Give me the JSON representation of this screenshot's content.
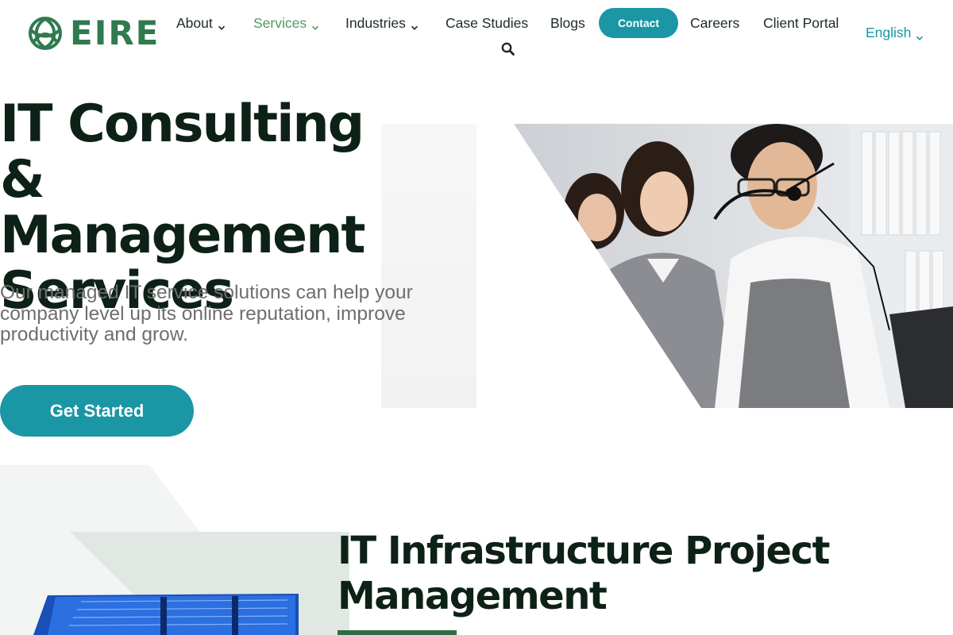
{
  "brand": {
    "name": "EIRE",
    "logo_icon": "celtic-knot-icon",
    "color": "#2f7a4e"
  },
  "nav": {
    "items": [
      {
        "label": "About",
        "has_dropdown": true
      },
      {
        "label": "Services",
        "has_dropdown": true,
        "active": true
      },
      {
        "label": "Industries",
        "has_dropdown": true
      },
      {
        "label": "Case Studies",
        "has_dropdown": false
      },
      {
        "label": "Blogs",
        "has_dropdown": false
      }
    ],
    "contact_label": "Contact",
    "items_right": [
      {
        "label": "Careers"
      },
      {
        "label": "Client Portal"
      }
    ],
    "search_icon": "search-icon",
    "language": "English"
  },
  "hero": {
    "title": "IT Consulting & Management Services",
    "subtitle": "Our managed IT service solutions can help your company level up its online reputation, improve productivity and grow.",
    "cta_label": "Get Started",
    "image": "call-center-agents-with-headsets-photo"
  },
  "section2": {
    "title": "IT Infrastructure Project Management",
    "image": "server-rack-photo"
  },
  "colors": {
    "accent": "#1a96a5",
    "brand_green": "#2f7a4e",
    "active_nav": "#4f9a5f",
    "heading": "#0d2117",
    "body_text": "#6e6e6e"
  }
}
